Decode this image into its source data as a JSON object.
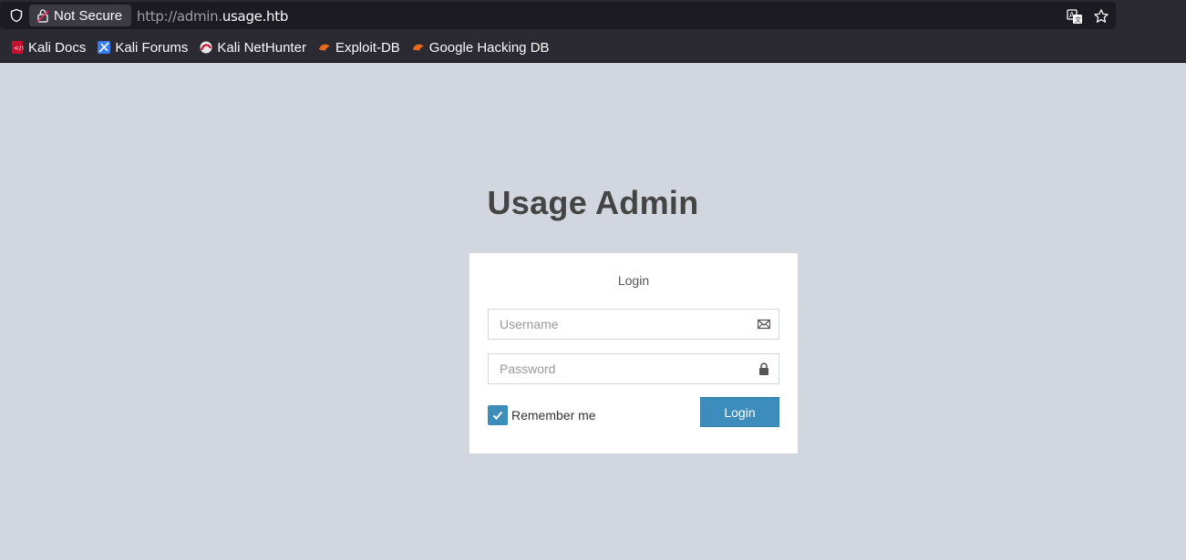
{
  "browser": {
    "security_label": "Not Secure",
    "url_prefix": "http://admin.",
    "url_host": "usage.htb",
    "bookmarks": [
      {
        "label": "Kali Docs",
        "icon": "kali-docs-icon"
      },
      {
        "label": "Kali Forums",
        "icon": "kali-forums-icon"
      },
      {
        "label": "Kali NetHunter",
        "icon": "kali-nethunter-icon"
      },
      {
        "label": "Exploit-DB",
        "icon": "exploit-db-icon"
      },
      {
        "label": "Google Hacking DB",
        "icon": "google-hacking-db-icon"
      }
    ]
  },
  "login": {
    "title": "Usage Admin",
    "box_message": "Login",
    "username_placeholder": "Username",
    "password_placeholder": "Password",
    "remember_label": "Remember me",
    "remember_checked": true,
    "submit_label": "Login"
  },
  "colors": {
    "accent": "#3c8dbc",
    "page_background": "#d2d6de",
    "chrome_background": "#2b2a33"
  }
}
